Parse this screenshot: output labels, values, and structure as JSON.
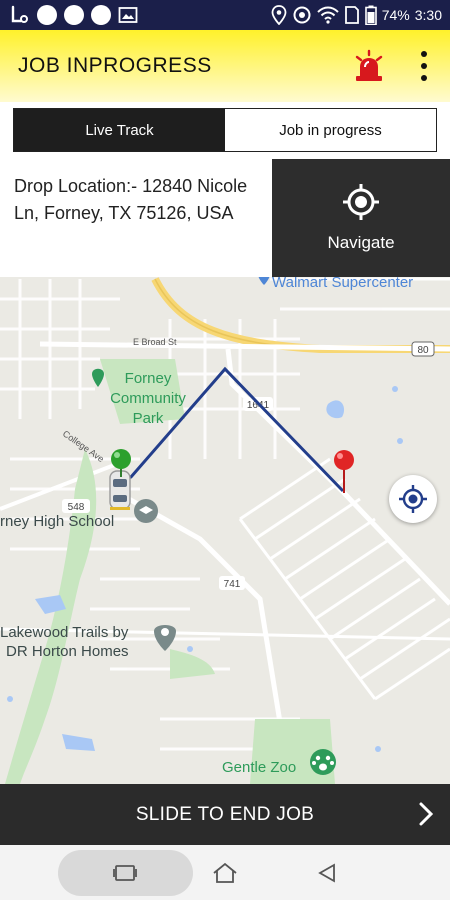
{
  "status_bar": {
    "battery": "74%",
    "time": "3:30",
    "icons": [
      "app-icon",
      "notification-dot",
      "notification-dot",
      "notification-dot",
      "image-icon",
      "location-icon",
      "sync-icon",
      "wifi-icon",
      "sim-icon",
      "battery-icon"
    ]
  },
  "header": {
    "title": "JOB INPROGRESS",
    "alarm_icon": "alarm-light-icon",
    "menu_icon": "more-vert-icon"
  },
  "tabs": [
    {
      "label": "Live Track",
      "active": true
    },
    {
      "label": "Job in progress",
      "active": false
    }
  ],
  "drop": {
    "label": "Drop Location:- 12840 Nicole Ln, Forney, TX 75126, USA"
  },
  "navigate": {
    "label": "Navigate",
    "icon": "crosshair-icon"
  },
  "map": {
    "labels": {
      "walmart": "Walmart Supercenter",
      "broad_st": "E Broad St",
      "road_80": "80",
      "park": "Forney Community Park",
      "road_1641": "1641",
      "college_ave": "College Ave",
      "road_548": "548",
      "high_school": "rney High School",
      "road_741": "741",
      "lakewood": "Lakewood Trails by DR Horton Homes",
      "zoo": "Gentle Zoo"
    },
    "colors": {
      "route": "#233e8b",
      "highway": "#f7d774",
      "park": "#c8e6c0",
      "water": "#a9c8f5",
      "poi_blue": "#4e86d6",
      "poi_green": "#2e9b5a",
      "poi_gray": "#7a8a8a"
    }
  },
  "slide": {
    "label": "SLIDE TO END JOB",
    "icon": "chevron-right-icon"
  },
  "nav_bar": {
    "icons": [
      "recents-icon",
      "home-icon",
      "back-icon"
    ]
  }
}
